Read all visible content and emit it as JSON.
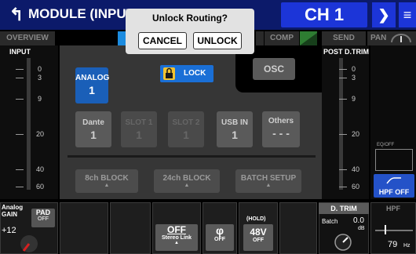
{
  "header": {
    "back_icon": "↰",
    "title": "MODULE (INPUT)",
    "channel": "CH 1",
    "next_icon": "❯",
    "menu_icon": "≡"
  },
  "tabs": {
    "overview": "OVERVIEW",
    "comp": "COMP",
    "send": "SEND",
    "pan": "PAN"
  },
  "input_meter": {
    "label": "INPUT",
    "scale": [
      "0",
      "3",
      "9",
      "20",
      "40",
      "60"
    ]
  },
  "post_meter": {
    "label": "POST D.TRIM",
    "scale": [
      "0",
      "3",
      "9",
      "20",
      "40",
      "60"
    ]
  },
  "routing": {
    "lock_label": "LOCK",
    "osc_label": "OSC",
    "sources": [
      {
        "label": "ANALOG",
        "number": "1"
      },
      {
        "label": "Dante",
        "number": "1"
      },
      {
        "label": "SLOT 1",
        "number": "1"
      },
      {
        "label": "SLOT 2",
        "number": "1"
      },
      {
        "label": "USB IN",
        "number": "1"
      },
      {
        "label": "Others",
        "number": "- - -"
      }
    ],
    "blocks": [
      "8ch BLOCK",
      "24ch BLOCK",
      "BATCH SETUP"
    ]
  },
  "eq": {
    "label": "EQ/OFF",
    "hpf_label": "HPF OFF"
  },
  "bottom": {
    "analog_gain_label": "Analog\nGAIN",
    "gain_value": "+12",
    "pad_label": "PAD",
    "pad_state": "OFF",
    "stereo_link_value": "OFF",
    "stereo_link_label": "Stereo Link",
    "phase_symbol": "φ",
    "phase_state": "OFF",
    "phantom_hold": "(HOLD)",
    "phantom_label": "48V",
    "phantom_state": "OFF",
    "dtrim_label": "D. TRIM",
    "batch_label": "Batch",
    "dtrim_value": "0.0",
    "dtrim_unit": "dB",
    "hpf_label": "HPF",
    "hpf_value": "79",
    "hpf_unit": "Hz"
  },
  "popup": {
    "title": "Unlock Routing?",
    "cancel": "CANCEL",
    "unlock": "UNLOCK"
  },
  "colors": {
    "header_bg": "#0c1a6a",
    "accent_blue": "#1c35d8",
    "analog_selected": "#1a5fb8",
    "lock_bg": "#1a6fd6",
    "lock_icon": "#f2c230",
    "comp_green": "#2e7d32",
    "knob_red": "#d62020"
  }
}
